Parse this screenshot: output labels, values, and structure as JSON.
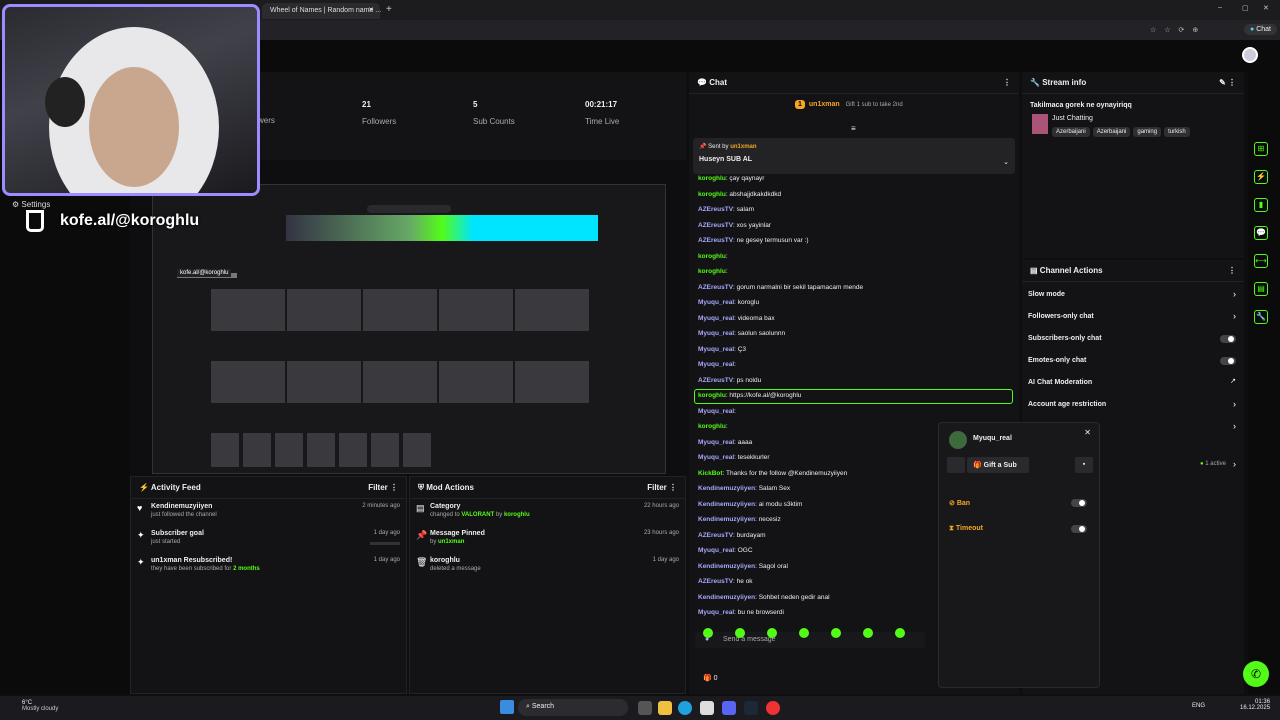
{
  "browser": {
    "tab_title": "Wheel of Names | Random name ...",
    "chat_button": "Chat"
  },
  "overlay": {
    "settings_label": "Settings",
    "kofe_text": "kofe.al/@koroghlu",
    "preview_kofe": "kofe.al/@koroghlu"
  },
  "stats": {
    "viewers_label": "wers",
    "followers_num": "21",
    "followers_label": "Followers",
    "subs_num": "5",
    "subs_label": "Sub Counts",
    "time_num": "00:21:17",
    "time_label": "Time Live"
  },
  "activity": {
    "title": "Activity Feed",
    "filter": "Filter",
    "items": [
      {
        "name": "Kendinemuzyiiyen",
        "detail": "just followed the channel",
        "time": "2 minutes ago"
      },
      {
        "name": "Subscriber goal",
        "detail": "just started",
        "time": "1 day ago"
      },
      {
        "name": "un1xman Resubscribed!",
        "detail_pre": "they have been subscribed for",
        "detail_num": "2 months",
        "time": "1 day ago"
      }
    ]
  },
  "modactions": {
    "title": "Mod Actions",
    "filter": "Filter",
    "items": [
      {
        "name": "Category",
        "pre": "changed to",
        "val": "VALORANT",
        "mid": "by",
        "user": "koroghlu",
        "time": "22 hours ago"
      },
      {
        "name": "Message Pinned",
        "pre": "by",
        "user": "un1xman",
        "time": "23 hours ago"
      },
      {
        "name": "koroghlu",
        "detail": "deleted a message",
        "time": "1 day ago"
      }
    ]
  },
  "chat": {
    "title": "Chat",
    "top_gifter": "un1xman",
    "top_gifter_count": "1",
    "gift_hint": "Gift 1 sub to take 2nd",
    "pinned_by_label": "Sent by",
    "pinned_by": "un1xman",
    "pinned_msg": "Huseyn SUB AL",
    "messages": [
      {
        "user": "koroghlu",
        "text": ": çay qaynayr"
      },
      {
        "user": "koroghlu",
        "text": ": abshajjdkakdkdkd"
      },
      {
        "user": "AZEreusTV",
        "text": ": salam"
      },
      {
        "user": "AZEreusTV",
        "text": ": xos yayinlar"
      },
      {
        "user": "AZEreusTV",
        "text": ": ne gesey termusun var :)"
      },
      {
        "user": "koroghlu",
        "text": ":"
      },
      {
        "user": "koroghlu",
        "text": ":"
      },
      {
        "user": "AZEreusTV",
        "text": ": gorum narmalni bir sekil tapamacam mende"
      },
      {
        "user": "Myuqu_real",
        "text": ": koroglu"
      },
      {
        "user": "Myuqu_real",
        "text": ": videoma bax"
      },
      {
        "user": "Myuqu_real",
        "text": ": saolun saolunnn"
      },
      {
        "user": "Myuqu_real",
        "text": ": Ç3"
      },
      {
        "user": "Myuqu_real",
        "text": ":"
      },
      {
        "user": "AZEreusTV",
        "text": ": ps noldu"
      },
      {
        "user": "koroghlu",
        "text": ": https://kofe.al/@koroghlu"
      },
      {
        "user": "Myuqu_real",
        "text": ":"
      },
      {
        "user": "koroghlu",
        "text": ":"
      },
      {
        "user": "Myuqu_real",
        "text": ": aaaa"
      },
      {
        "user": "Myuqu_real",
        "text": ": tesekkurler"
      },
      {
        "user": "KickBot",
        "text": ": Thanks for the follow @Kendinemuzyiiyen"
      },
      {
        "user": "Kendinemuzyiiyen",
        "text": ": Salam Sex"
      },
      {
        "user": "Kendinemuzyiiyen",
        "text": ": ai modu s3ktim"
      },
      {
        "user": "Kendinemuzyiiyen",
        "text": ": necesiz"
      },
      {
        "user": "AZEreusTV",
        "text": ": burdayam"
      },
      {
        "user": "Myuqu_real",
        "text": ": OGC"
      },
      {
        "user": "Kendinemuzyiiyen",
        "text": ": Sagol oral"
      },
      {
        "user": "AZEreusTV",
        "text": ": he ok"
      },
      {
        "user": "Kendinemuzyiiyen",
        "text": ": Sohbet neden gedir anal"
      },
      {
        "user": "Myuqu_real",
        "text": ": bu ne browserdi"
      }
    ],
    "input_placeholder": "Send a message",
    "points": "0"
  },
  "streaminfo": {
    "title": "Stream info",
    "stream_title": "Takilmaca gorek ne oynayiriqq",
    "category": "Just Chatting",
    "tags": [
      "Azerbaijani",
      "Azerbaijani",
      "gaming",
      "turkish"
    ]
  },
  "channel_actions": {
    "title": "Channel Actions",
    "items": [
      "Slow mode",
      "Followers-only chat",
      "Subscribers-only chat",
      "Emotes-only chat",
      "AI Chat Moderation",
      "Account age restriction"
    ],
    "active_label": "1 active"
  },
  "usercard": {
    "username": "Myuqu_real",
    "gift_label": "Gift a Sub",
    "ban_label": "Ban",
    "timeout_label": "Timeout"
  },
  "taskbar": {
    "weather_temp": "6°C",
    "weather_desc": "Mostly cloudy",
    "search": "Search",
    "lang": "ENG",
    "time": "01:36",
    "date": "16.12.2025"
  }
}
